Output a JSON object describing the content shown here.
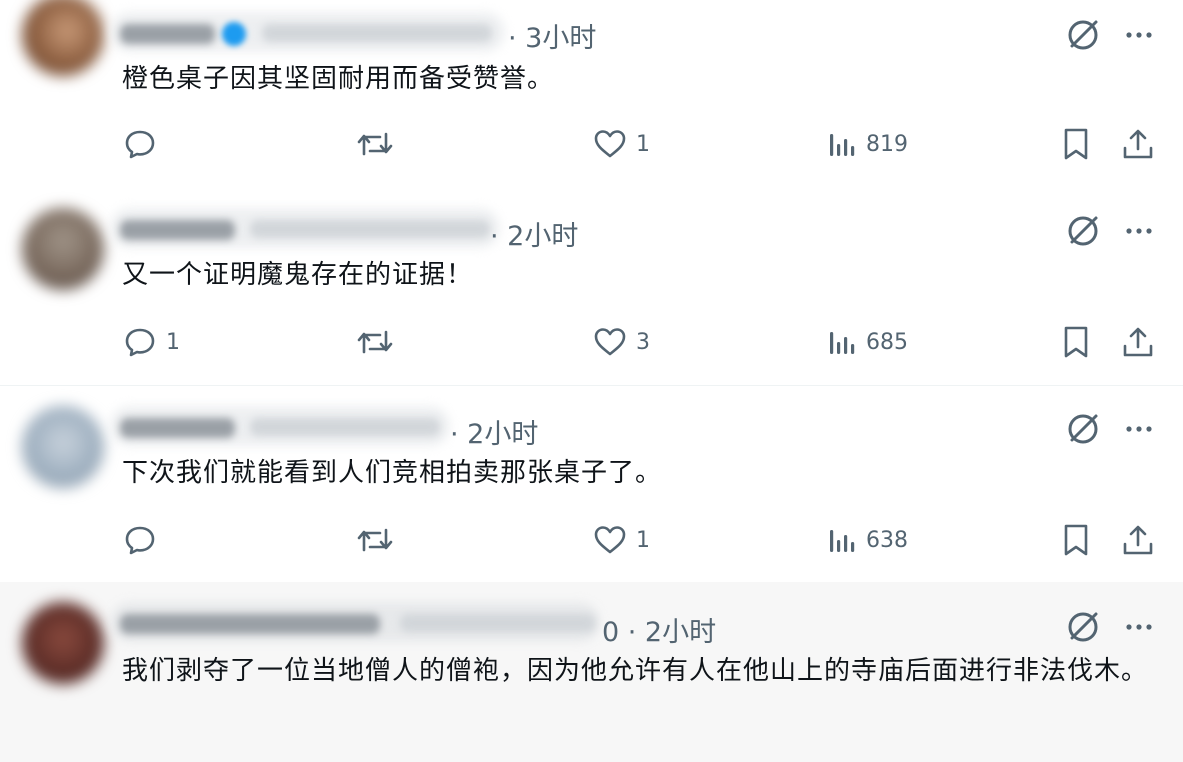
{
  "posts": [
    {
      "time": "· 3小时",
      "text": "橙色桌子因其坚固耐用而备受赞誉。",
      "reply_count": "",
      "retweet_count": "",
      "like_count": "1",
      "views": "819"
    },
    {
      "time": "· 2小时",
      "text": "又一个证明魔鬼存在的证据！",
      "reply_count": "1",
      "retweet_count": "",
      "like_count": "3",
      "views": "685"
    },
    {
      "time": "· 2小时",
      "text": "下次我们就能看到人们竞相拍卖那张桌子了。",
      "reply_count": "",
      "retweet_count": "",
      "like_count": "1",
      "views": "638"
    },
    {
      "time": "0 · 2小时",
      "text": "我们剥夺了一位当地僧人的僧袍，因为他允许有人在他山上的寺庙后面进行非法伐木。",
      "reply_count": "",
      "retweet_count": "",
      "like_count": "",
      "views": ""
    }
  ],
  "colors": {
    "text": "#0f1419",
    "secondary": "#536471",
    "divider": "#eff3f4",
    "highlight_bg": "#f7f7f7"
  },
  "icons": [
    "grok-icon",
    "more-icon",
    "reply-icon",
    "retweet-icon",
    "like-icon",
    "views-icon",
    "bookmark-icon",
    "share-icon"
  ]
}
